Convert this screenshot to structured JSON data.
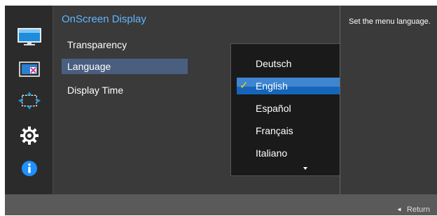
{
  "osd": {
    "title": "OnScreen Display",
    "menu_items": [
      {
        "label": "Transparency"
      },
      {
        "label": "Language",
        "selected": true
      },
      {
        "label": "Display Time"
      }
    ]
  },
  "language_dropdown": {
    "options": [
      "Deutsch",
      "English",
      "Español",
      "Français",
      "Italiano"
    ],
    "selected": "English",
    "more_indicator": "chevron-down-icon"
  },
  "help_text": "Set the menu language.",
  "footer": {
    "return_label": "Return",
    "return_icon": "left-arrow-icon"
  },
  "icons": [
    "picture-icon",
    "color-icon",
    "size-position-icon",
    "gear-icon",
    "info-icon"
  ],
  "colors": {
    "accent_title": "#5fb6ff",
    "selection": "#1566bb",
    "check": "#ffd400",
    "info": "#1e90ff"
  }
}
